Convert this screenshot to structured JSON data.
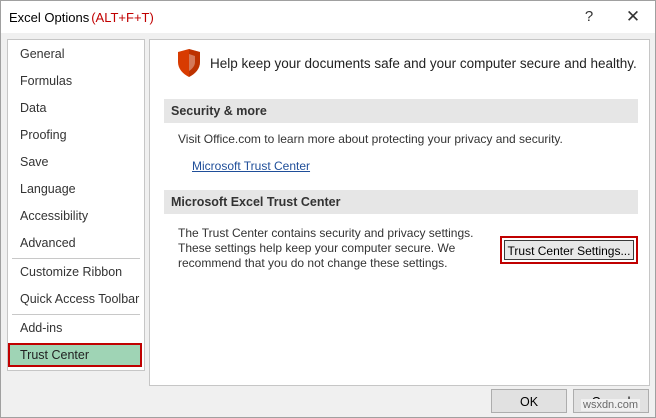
{
  "window": {
    "title": "Excel Options",
    "title_shortcut": "(ALT+F+T)",
    "help_glyph": "?",
    "close_glyph": "✕",
    "accent_color": "#c00000"
  },
  "sidebar": {
    "items": [
      {
        "label": "General"
      },
      {
        "label": "Formulas"
      },
      {
        "label": "Data"
      },
      {
        "label": "Proofing"
      },
      {
        "label": "Save"
      },
      {
        "label": "Language"
      },
      {
        "label": "Accessibility"
      },
      {
        "label": "Advanced"
      },
      {
        "label": "Customize Ribbon"
      },
      {
        "label": "Quick Access Toolbar"
      },
      {
        "label": "Add-ins"
      },
      {
        "label": "Trust Center"
      }
    ],
    "selected": "Trust Center",
    "selected_color": "#9fd4b5"
  },
  "main": {
    "headline": "Help keep your documents safe and your computer secure and healthy.",
    "security_section": {
      "header": "Security & more",
      "text": "Visit Office.com to learn more about protecting your privacy and security.",
      "link": "Microsoft Trust Center"
    },
    "trust_section": {
      "header": "Microsoft Excel Trust Center",
      "description": "The Trust Center contains security and privacy settings. These settings help keep your computer secure. We recommend that you do not change these settings.",
      "button_label": "Trust Center Settings..."
    }
  },
  "footer": {
    "ok_label": "OK",
    "cancel_label": "Cancel"
  },
  "watermark": "wsxdn.com"
}
